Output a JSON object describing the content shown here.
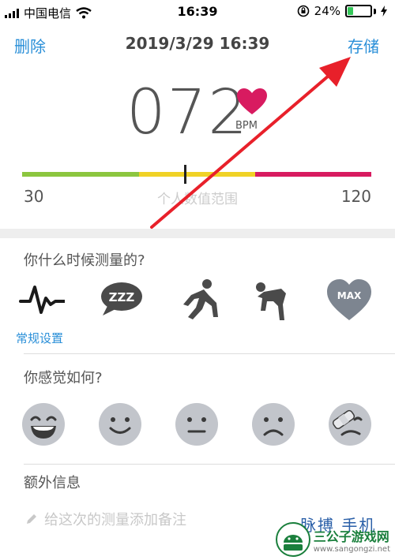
{
  "status_bar": {
    "carrier": "中国电信",
    "time": "16:39",
    "battery_text": "24%",
    "battery_level": 0.24
  },
  "header": {
    "delete_label": "删除",
    "title": "2019/3/29 16:39",
    "save_label": "存储"
  },
  "reading": {
    "value": "072",
    "unit": "BPM"
  },
  "range": {
    "min": "30",
    "max": "120",
    "label": "个人数值范围",
    "marker_value": 72,
    "segments": [
      {
        "color": "#8cc63f"
      },
      {
        "color": "#f0d226"
      },
      {
        "color": "#d81b60"
      }
    ]
  },
  "when": {
    "title": "你什么时候测量的?",
    "active_label": "常规设置",
    "options": [
      {
        "icon": "heartbeat-wave-icon"
      },
      {
        "icon": "sleep-bubble-icon",
        "text": "ZZZ"
      },
      {
        "icon": "runner-start-icon"
      },
      {
        "icon": "tired-person-icon"
      },
      {
        "icon": "max-heart-icon",
        "text": "MAX"
      }
    ]
  },
  "feel": {
    "title": "你感觉如何?",
    "faces": [
      {
        "icon": "laughing-face-icon"
      },
      {
        "icon": "smiling-face-icon"
      },
      {
        "icon": "neutral-face-icon"
      },
      {
        "icon": "sad-face-icon"
      },
      {
        "icon": "injured-face-icon"
      }
    ]
  },
  "extra": {
    "title": "额外信息",
    "note_placeholder": "给这次的测量添加备注"
  },
  "watermark": {
    "name": "三公子游戏网",
    "url": "www.sangongzi.net",
    "partial_text": "脉搏 手机"
  },
  "colors": {
    "accent": "#2a8fd8",
    "heart": "#d81b60",
    "icon_gray": "#4a4a4a",
    "face_gray": "#c2c5cb",
    "arrow": "#e8202a"
  }
}
